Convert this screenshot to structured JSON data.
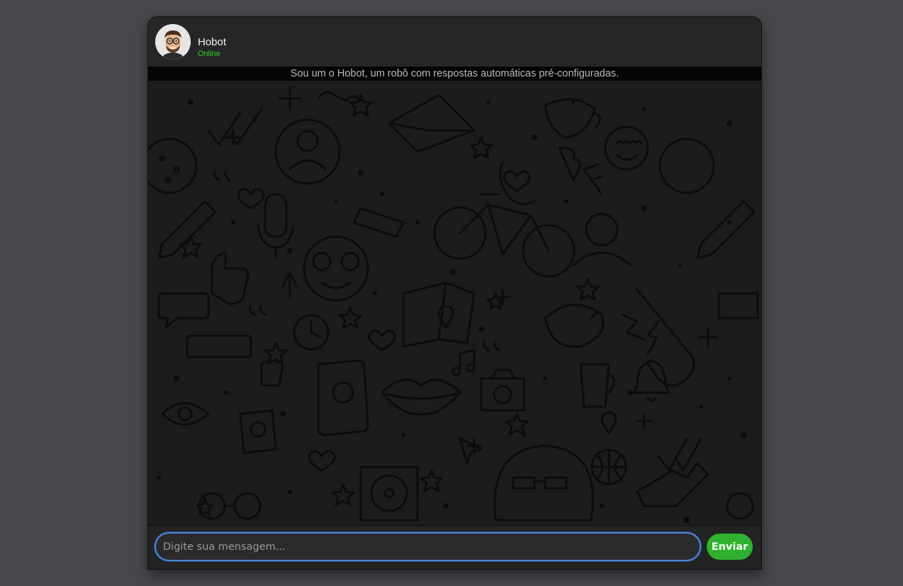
{
  "header": {
    "bot_name": "Hobot",
    "status": "Online",
    "avatar_icon": "memoji-avatar-icon"
  },
  "info_bar": {
    "text": "Sou um o Hobot, um robô com respostas automáticas pré-configuradas."
  },
  "chat": {
    "background": "doodle-pattern"
  },
  "composer": {
    "placeholder": "Digite sua mensagem...",
    "value": "",
    "send_label": "Enviar"
  },
  "colors": {
    "page_bg": "#45474b",
    "status_green": "#29d629",
    "send_green": "#2fb12f",
    "input_focus": "#4f86d8"
  }
}
